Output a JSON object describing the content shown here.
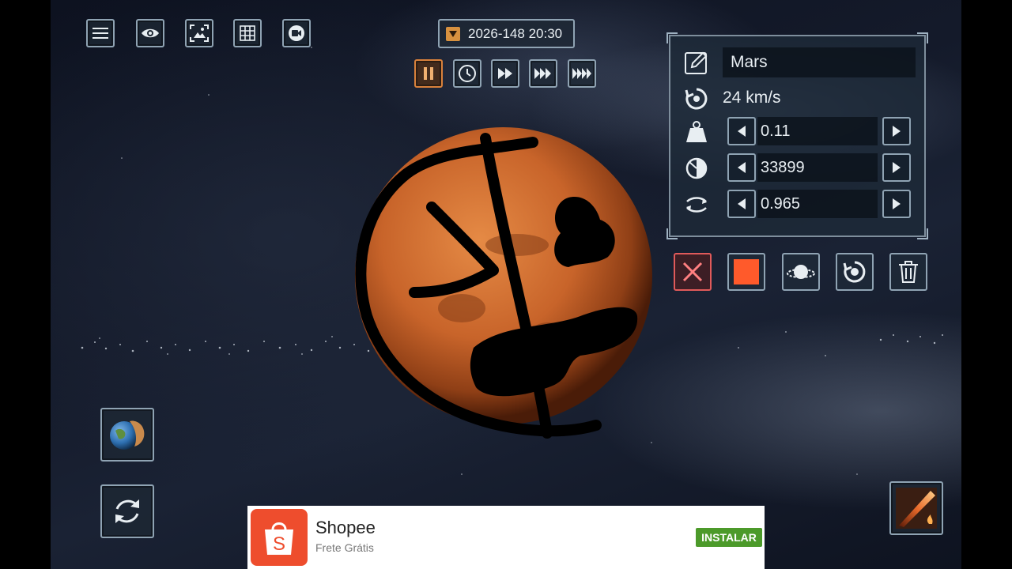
{
  "toolbar": {
    "icons": [
      "menu-icon",
      "eye-icon",
      "image-icon",
      "grid-icon",
      "camera-icon"
    ]
  },
  "time": {
    "date": "2026-148 20:30",
    "speeds": [
      "pause-icon",
      "clock-icon",
      "fast-forward-icon",
      "faster-forward-icon",
      "fastest-forward-icon"
    ],
    "active_speed": "pause-icon"
  },
  "object_panel": {
    "name": "Mars",
    "velocity": "24 km/s",
    "mass": "0.11",
    "diameter": "33899",
    "rotation": "0.965"
  },
  "actions": [
    "close-icon",
    "color-square-icon",
    "ring-planet-icon",
    "orbit-reset-icon",
    "trash-icon"
  ],
  "colors": {
    "accent_orange": "#d9813b",
    "close_red": "#e04848",
    "object_color": "#ff5a2b",
    "panel_border": "#8fa3b3"
  },
  "ad": {
    "brand": "Shopee",
    "subtitle": "Frete Grátis",
    "cta": "INSTALAR",
    "logo_letter": "S"
  }
}
